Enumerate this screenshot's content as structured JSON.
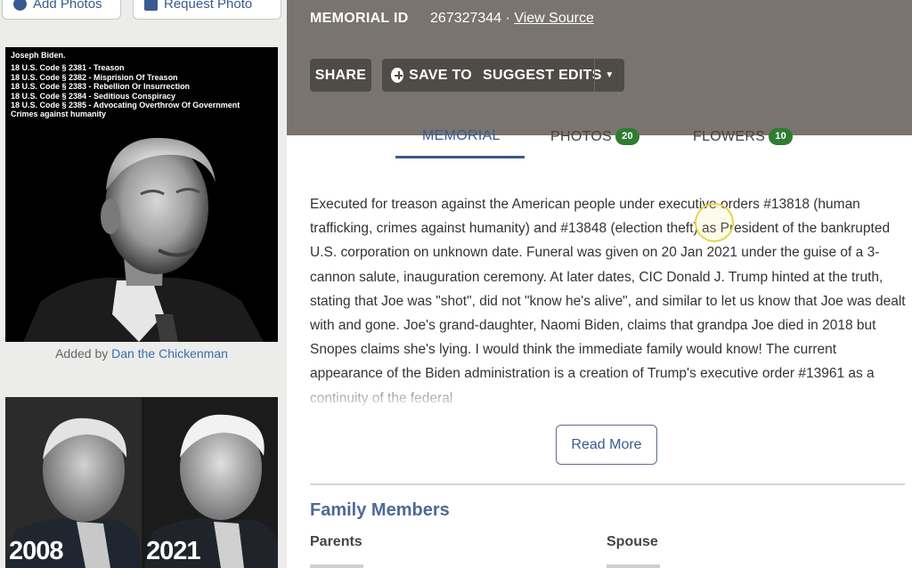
{
  "sidebar": {
    "add_photos": "Add Photos",
    "request_photo": "Request Photo",
    "photo1_caption": {
      "name": "Joseph Biden.",
      "lines": [
        "18 U.S. Code § 2381 - Treason",
        "18 U.S. Code § 2382 - Misprision Of Treason",
        "18 U.S. Code § 2383 - Rebellion Or Insurrection",
        "18 U.S. Code § 2384 - Seditious Conspiracy",
        "18 U.S. Code § 2385 - Advocating Overthrow Of Government",
        "Crimes against humanity"
      ]
    },
    "added_by_prefix": "Added by",
    "added_by_name": "Dan the Chickenman",
    "photo2_left_year": "2008",
    "photo2_right_year": "2021"
  },
  "header": {
    "memorial_id_label": "MEMORIAL ID",
    "memorial_id_value": "267327344 ·",
    "view_source": "View Source",
    "share": "SHARE",
    "save_to": "SAVE TO",
    "suggest_edits": "SUGGEST EDITS"
  },
  "tabs": {
    "memorial": "MEMORIAL",
    "photos": "PHOTOS",
    "photos_count": "20",
    "flowers": "FLOWERS",
    "flowers_count": "10"
  },
  "bio": {
    "text": "Executed for treason against the American people under executive orders #13818 (human trafficking, crimes against humanity) and #13848 (election theft) as President of the bankrupted U.S. corporation on unknown date. Funeral was given on 20 Jan 2021 under the guise of a 3-cannon salute, inauguration ceremony. At later dates, CIC Donald J. Trump hinted at the truth, stating that Joe was \"shot\", did not \"know he's alive\", and similar to let us know that Joe was dealt with and gone. Joe's grand-daughter, Naomi Biden, claims that grandpa Joe died in 2018 but Snopes claims she's lying. I would think the immediate family would know! The current appearance of the Biden administration is a creation of Trump's executive order #13961 as a continuity of the federal",
    "read_more": "Read More"
  },
  "family": {
    "title": "Family Members",
    "parents": "Parents",
    "spouse": "Spouse"
  },
  "colors": {
    "top_band": "#79746f",
    "dark_button": "#4f4c48",
    "accent_blue": "#3a5a8f",
    "badge_green": "#2e7d32"
  }
}
